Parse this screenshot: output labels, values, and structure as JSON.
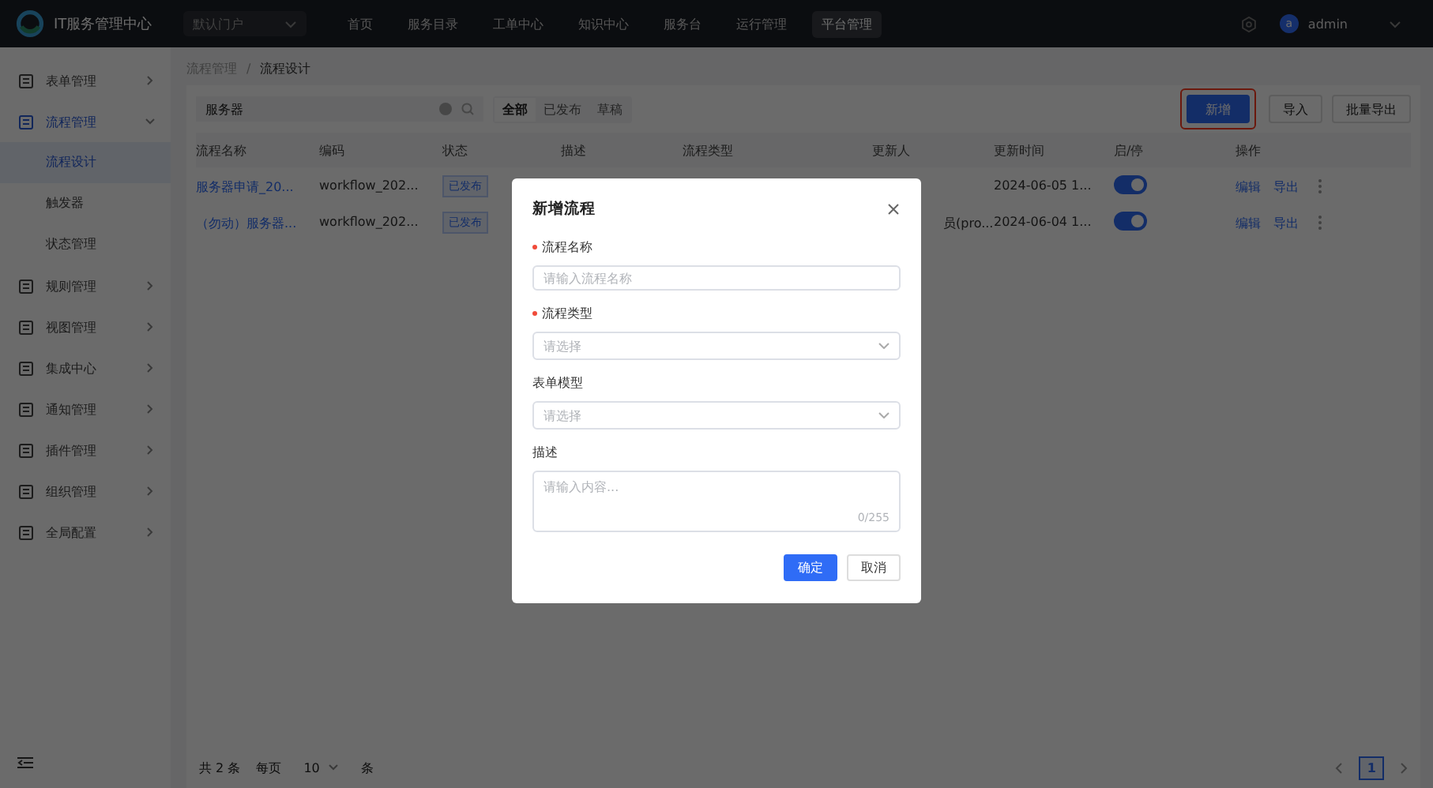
{
  "topbar": {
    "title": "IT服务管理中心",
    "portal": "默认门户",
    "nav": [
      {
        "label": "首页",
        "selected": false
      },
      {
        "label": "服务目录",
        "selected": false
      },
      {
        "label": "工单中心",
        "selected": false
      },
      {
        "label": "知识中心",
        "selected": false
      },
      {
        "label": "服务台",
        "selected": false
      },
      {
        "label": "运行管理",
        "selected": false
      },
      {
        "label": "平台管理",
        "selected": true
      }
    ],
    "avatar": "a",
    "user": "admin"
  },
  "sidebar": {
    "items": [
      {
        "label": "表单管理",
        "expanded": false,
        "selected": false
      },
      {
        "label": "流程管理",
        "expanded": true,
        "selected": true,
        "children": [
          {
            "label": "流程设计",
            "selected": true
          },
          {
            "label": "触发器",
            "selected": false
          },
          {
            "label": "状态管理",
            "selected": false
          }
        ]
      },
      {
        "label": "规则管理",
        "expanded": false,
        "selected": false
      },
      {
        "label": "视图管理",
        "expanded": false,
        "selected": false
      },
      {
        "label": "集成中心",
        "expanded": false,
        "selected": false
      },
      {
        "label": "通知管理",
        "expanded": false,
        "selected": false
      },
      {
        "label": "插件管理",
        "expanded": false,
        "selected": false
      },
      {
        "label": "组织管理",
        "expanded": false,
        "selected": false
      },
      {
        "label": "全局配置",
        "expanded": false,
        "selected": false
      }
    ]
  },
  "breadcrumb": {
    "items": [
      "流程管理",
      "流程设计"
    ],
    "separator": "/"
  },
  "toolbar": {
    "search": "服务器",
    "filters": [
      {
        "label": "全部",
        "selected": true
      },
      {
        "label": "已发布",
        "selected": false
      },
      {
        "label": "草稿",
        "selected": false
      }
    ],
    "buttons": [
      {
        "label": "新增",
        "kind": "primary",
        "highlighted": true
      },
      {
        "label": "导入",
        "kind": "plain"
      },
      {
        "label": "批量导出",
        "kind": "plain"
      }
    ]
  },
  "table": {
    "columns": [
      "流程名称",
      "编码",
      "状态",
      "描述",
      "流程类型",
      "更新人",
      "更新时间",
      "启/停",
      "操作"
    ],
    "rows": [
      {
        "name": "服务器申请_20...",
        "code": "workflow_202...",
        "status": "已发布",
        "time": "2024-06-05 1...",
        "on": true,
        "actions": [
          "编辑",
          "导出"
        ]
      },
      {
        "name": "（勿动）服务器...",
        "code": "workflow_202...",
        "status": "已发布",
        "updater": "员(pro...",
        "time": "2024-06-04 1...",
        "on": true,
        "actions": [
          "编辑",
          "导出"
        ]
      }
    ]
  },
  "pagination": {
    "total": "共 2 条",
    "per_page_label": "每页",
    "per_page": "10",
    "unit": "条",
    "pages": [
      {
        "label": "1",
        "selected": true
      }
    ]
  },
  "dialog": {
    "title": "新增流程",
    "fields": [
      {
        "label": "流程名称",
        "required": true,
        "kind": "input",
        "placeholder": "请输入流程名称"
      },
      {
        "label": "流程类型",
        "required": true,
        "kind": "select",
        "placeholder": "请选择"
      },
      {
        "label": "表单模型",
        "required": false,
        "kind": "select",
        "placeholder": "请选择"
      },
      {
        "label": "描述",
        "required": false,
        "kind": "textarea",
        "placeholder": "请输入内容...",
        "counter": "0/255"
      }
    ],
    "buttons": [
      {
        "label": "确定",
        "kind": "primary"
      },
      {
        "label": "取消",
        "kind": "plain"
      }
    ]
  }
}
